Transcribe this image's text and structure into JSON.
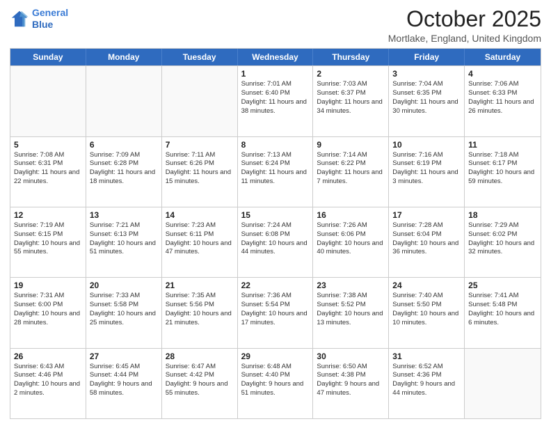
{
  "header": {
    "logo_line1": "General",
    "logo_line2": "Blue",
    "month_title": "October 2025",
    "location": "Mortlake, England, United Kingdom"
  },
  "days_of_week": [
    "Sunday",
    "Monday",
    "Tuesday",
    "Wednesday",
    "Thursday",
    "Friday",
    "Saturday"
  ],
  "weeks": [
    [
      {
        "day": "",
        "text": ""
      },
      {
        "day": "",
        "text": ""
      },
      {
        "day": "",
        "text": ""
      },
      {
        "day": "1",
        "text": "Sunrise: 7:01 AM\nSunset: 6:40 PM\nDaylight: 11 hours\nand 38 minutes."
      },
      {
        "day": "2",
        "text": "Sunrise: 7:03 AM\nSunset: 6:37 PM\nDaylight: 11 hours\nand 34 minutes."
      },
      {
        "day": "3",
        "text": "Sunrise: 7:04 AM\nSunset: 6:35 PM\nDaylight: 11 hours\nand 30 minutes."
      },
      {
        "day": "4",
        "text": "Sunrise: 7:06 AM\nSunset: 6:33 PM\nDaylight: 11 hours\nand 26 minutes."
      }
    ],
    [
      {
        "day": "5",
        "text": "Sunrise: 7:08 AM\nSunset: 6:31 PM\nDaylight: 11 hours\nand 22 minutes."
      },
      {
        "day": "6",
        "text": "Sunrise: 7:09 AM\nSunset: 6:28 PM\nDaylight: 11 hours\nand 18 minutes."
      },
      {
        "day": "7",
        "text": "Sunrise: 7:11 AM\nSunset: 6:26 PM\nDaylight: 11 hours\nand 15 minutes."
      },
      {
        "day": "8",
        "text": "Sunrise: 7:13 AM\nSunset: 6:24 PM\nDaylight: 11 hours\nand 11 minutes."
      },
      {
        "day": "9",
        "text": "Sunrise: 7:14 AM\nSunset: 6:22 PM\nDaylight: 11 hours\nand 7 minutes."
      },
      {
        "day": "10",
        "text": "Sunrise: 7:16 AM\nSunset: 6:19 PM\nDaylight: 11 hours\nand 3 minutes."
      },
      {
        "day": "11",
        "text": "Sunrise: 7:18 AM\nSunset: 6:17 PM\nDaylight: 10 hours\nand 59 minutes."
      }
    ],
    [
      {
        "day": "12",
        "text": "Sunrise: 7:19 AM\nSunset: 6:15 PM\nDaylight: 10 hours\nand 55 minutes."
      },
      {
        "day": "13",
        "text": "Sunrise: 7:21 AM\nSunset: 6:13 PM\nDaylight: 10 hours\nand 51 minutes."
      },
      {
        "day": "14",
        "text": "Sunrise: 7:23 AM\nSunset: 6:11 PM\nDaylight: 10 hours\nand 47 minutes."
      },
      {
        "day": "15",
        "text": "Sunrise: 7:24 AM\nSunset: 6:08 PM\nDaylight: 10 hours\nand 44 minutes."
      },
      {
        "day": "16",
        "text": "Sunrise: 7:26 AM\nSunset: 6:06 PM\nDaylight: 10 hours\nand 40 minutes."
      },
      {
        "day": "17",
        "text": "Sunrise: 7:28 AM\nSunset: 6:04 PM\nDaylight: 10 hours\nand 36 minutes."
      },
      {
        "day": "18",
        "text": "Sunrise: 7:29 AM\nSunset: 6:02 PM\nDaylight: 10 hours\nand 32 minutes."
      }
    ],
    [
      {
        "day": "19",
        "text": "Sunrise: 7:31 AM\nSunset: 6:00 PM\nDaylight: 10 hours\nand 28 minutes."
      },
      {
        "day": "20",
        "text": "Sunrise: 7:33 AM\nSunset: 5:58 PM\nDaylight: 10 hours\nand 25 minutes."
      },
      {
        "day": "21",
        "text": "Sunrise: 7:35 AM\nSunset: 5:56 PM\nDaylight: 10 hours\nand 21 minutes."
      },
      {
        "day": "22",
        "text": "Sunrise: 7:36 AM\nSunset: 5:54 PM\nDaylight: 10 hours\nand 17 minutes."
      },
      {
        "day": "23",
        "text": "Sunrise: 7:38 AM\nSunset: 5:52 PM\nDaylight: 10 hours\nand 13 minutes."
      },
      {
        "day": "24",
        "text": "Sunrise: 7:40 AM\nSunset: 5:50 PM\nDaylight: 10 hours\nand 10 minutes."
      },
      {
        "day": "25",
        "text": "Sunrise: 7:41 AM\nSunset: 5:48 PM\nDaylight: 10 hours\nand 6 minutes."
      }
    ],
    [
      {
        "day": "26",
        "text": "Sunrise: 6:43 AM\nSunset: 4:46 PM\nDaylight: 10 hours\nand 2 minutes."
      },
      {
        "day": "27",
        "text": "Sunrise: 6:45 AM\nSunset: 4:44 PM\nDaylight: 9 hours\nand 58 minutes."
      },
      {
        "day": "28",
        "text": "Sunrise: 6:47 AM\nSunset: 4:42 PM\nDaylight: 9 hours\nand 55 minutes."
      },
      {
        "day": "29",
        "text": "Sunrise: 6:48 AM\nSunset: 4:40 PM\nDaylight: 9 hours\nand 51 minutes."
      },
      {
        "day": "30",
        "text": "Sunrise: 6:50 AM\nSunset: 4:38 PM\nDaylight: 9 hours\nand 47 minutes."
      },
      {
        "day": "31",
        "text": "Sunrise: 6:52 AM\nSunset: 4:36 PM\nDaylight: 9 hours\nand 44 minutes."
      },
      {
        "day": "",
        "text": ""
      }
    ]
  ]
}
